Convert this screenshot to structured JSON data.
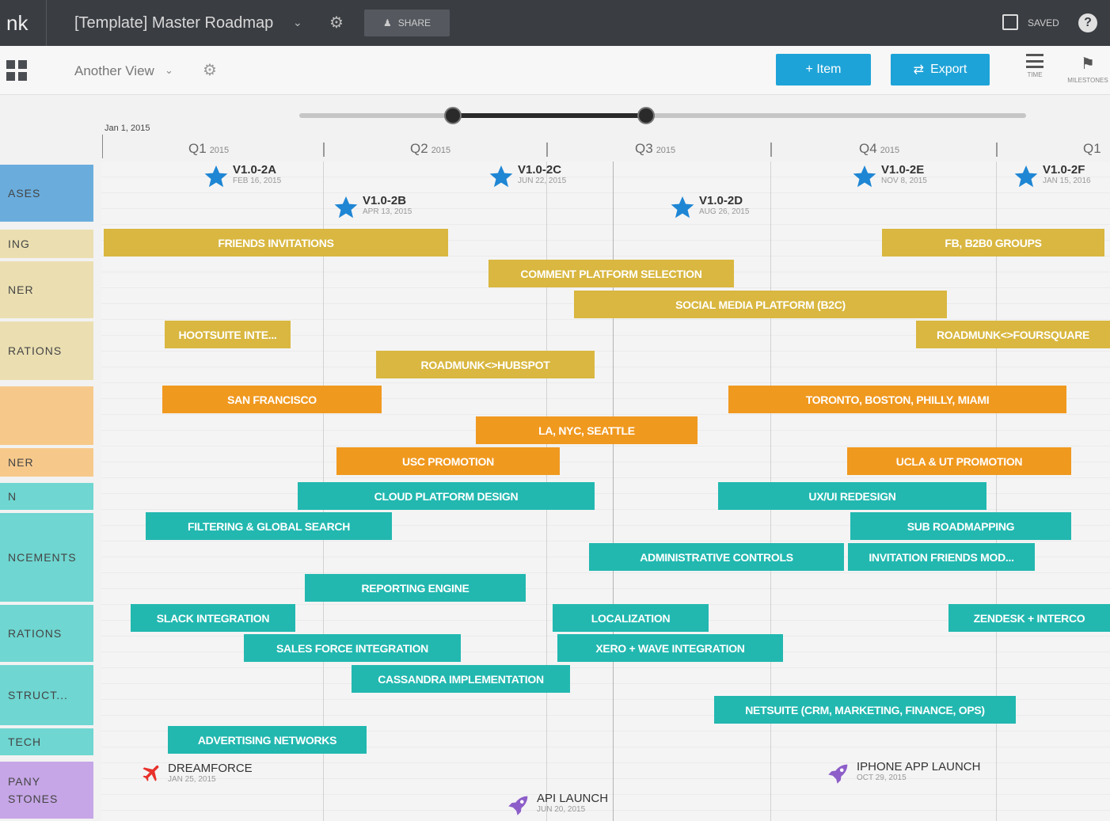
{
  "topbar": {
    "brand": "nk",
    "title": "[Template] Master Roadmap",
    "share_label": "SHARE",
    "saved_label": "SAVED",
    "help_label": "?"
  },
  "toolbar": {
    "view_label": "Another View",
    "add_item_label": "+ Item",
    "export_label": "Export",
    "timeline_caption": "TIME",
    "milestones_caption": "MILESTONES"
  },
  "timeline": {
    "start_date": "Jan 1, 2015",
    "quarters": [
      {
        "label": "Q1",
        "year": "2015"
      },
      {
        "label": "Q2",
        "year": "2015"
      },
      {
        "label": "Q3",
        "year": "2015"
      },
      {
        "label": "Q4",
        "year": "2015"
      },
      {
        "label": "Q1",
        "year": ""
      }
    ]
  },
  "lanes": [
    {
      "label": "ASES",
      "color": "#6aaddd"
    },
    {
      "label": "ING",
      "color": "#ebdfb2"
    },
    {
      "label": "NER",
      "color": "#ebdfb2"
    },
    {
      "label": "RATIONS",
      "color": "#ebdfb2"
    },
    {
      "label": "",
      "color": "#f6c98b"
    },
    {
      "label": "NER",
      "color": "#f6c98b"
    },
    {
      "label": "N",
      "color": "#6fd6d1"
    },
    {
      "label": "NCEMENTS",
      "color": "#6fd6d1"
    },
    {
      "label": "RATIONS",
      "color": "#6fd6d1"
    },
    {
      "label": "STRUCT...",
      "color": "#6fd6d1"
    },
    {
      "label": "TECH",
      "color": "#6fd6d1"
    },
    {
      "label": "PANY\nSTONES",
      "color": "#c6a6e6"
    }
  ],
  "releases": [
    {
      "name": "V1.0-2A",
      "date": "FEB 16, 2015"
    },
    {
      "name": "V1.0-2B",
      "date": "APR 13, 2015"
    },
    {
      "name": "V1.0-2C",
      "date": "JUN 22, 2015"
    },
    {
      "name": "V1.0-2D",
      "date": "AUG 26, 2015"
    },
    {
      "name": "V1.0-2E",
      "date": "NOV 8, 2015"
    },
    {
      "name": "V1.0-2F",
      "date": "JAN 15, 2016"
    }
  ],
  "bars": [
    {
      "label": "Friends Invitations",
      "color": "#d9b740"
    },
    {
      "label": "Comment Platform Selection",
      "color": "#d9b740"
    },
    {
      "label": "Social Media Platform (B2C)",
      "color": "#d9b740"
    },
    {
      "label": "FB, B2B0 Groups",
      "color": "#d9b740"
    },
    {
      "label": "Hootsuite Inte...",
      "color": "#d9b740"
    },
    {
      "label": "Roadmunk<>Hubspot",
      "color": "#d9b740"
    },
    {
      "label": "Roadmunk<>Foursquare",
      "color": "#d9b740"
    },
    {
      "label": "San Francisco",
      "color": "#f0991f"
    },
    {
      "label": "Toronto, Boston, Philly, Miami",
      "color": "#f0991f"
    },
    {
      "label": "LA, NYC, Seattle",
      "color": "#f0991f"
    },
    {
      "label": "USC Promotion",
      "color": "#f0991f"
    },
    {
      "label": "UCLA & UT Promotion",
      "color": "#f0991f"
    },
    {
      "label": "Cloud Platform Design",
      "color": "#22b8b0"
    },
    {
      "label": "UX/UI Redesign",
      "color": "#22b8b0"
    },
    {
      "label": "Filtering & Global Search",
      "color": "#22b8b0"
    },
    {
      "label": "Sub Roadmapping",
      "color": "#22b8b0"
    },
    {
      "label": "Administrative Controls",
      "color": "#22b8b0"
    },
    {
      "label": "Invitation Friends Mod...",
      "color": "#22b8b0"
    },
    {
      "label": "Reporting Engine",
      "color": "#22b8b0"
    },
    {
      "label": "Slack Integration",
      "color": "#22b8b0"
    },
    {
      "label": "Localization",
      "color": "#22b8b0"
    },
    {
      "label": "Zendesk + Interco",
      "color": "#22b8b0"
    },
    {
      "label": "Sales Force Integration",
      "color": "#22b8b0"
    },
    {
      "label": "Xero + Wave Integration",
      "color": "#22b8b0"
    },
    {
      "label": "Cassandra Implementation",
      "color": "#22b8b0"
    },
    {
      "label": "Netsuite (CRM, Marketing, Finance, Ops)",
      "color": "#22b8b0"
    },
    {
      "label": "Advertising Networks",
      "color": "#22b8b0"
    }
  ],
  "company_milestones": [
    {
      "name": "DREAMFORCE",
      "date": "JAN 25, 2015",
      "icon": "plane-icon",
      "color": "#e8322b"
    },
    {
      "name": "API LAUNCH",
      "date": "JUN 20, 2015",
      "icon": "rocket-icon",
      "color": "#8d5ec9"
    },
    {
      "name": "IPHONE APP LAUNCH",
      "date": "OCT 29, 2015",
      "icon": "rocket-icon",
      "color": "#8d5ec9"
    }
  ],
  "colors": {
    "topbar": "#3a3d42",
    "button": "#1ea3d8",
    "star": "#1f86d4"
  }
}
